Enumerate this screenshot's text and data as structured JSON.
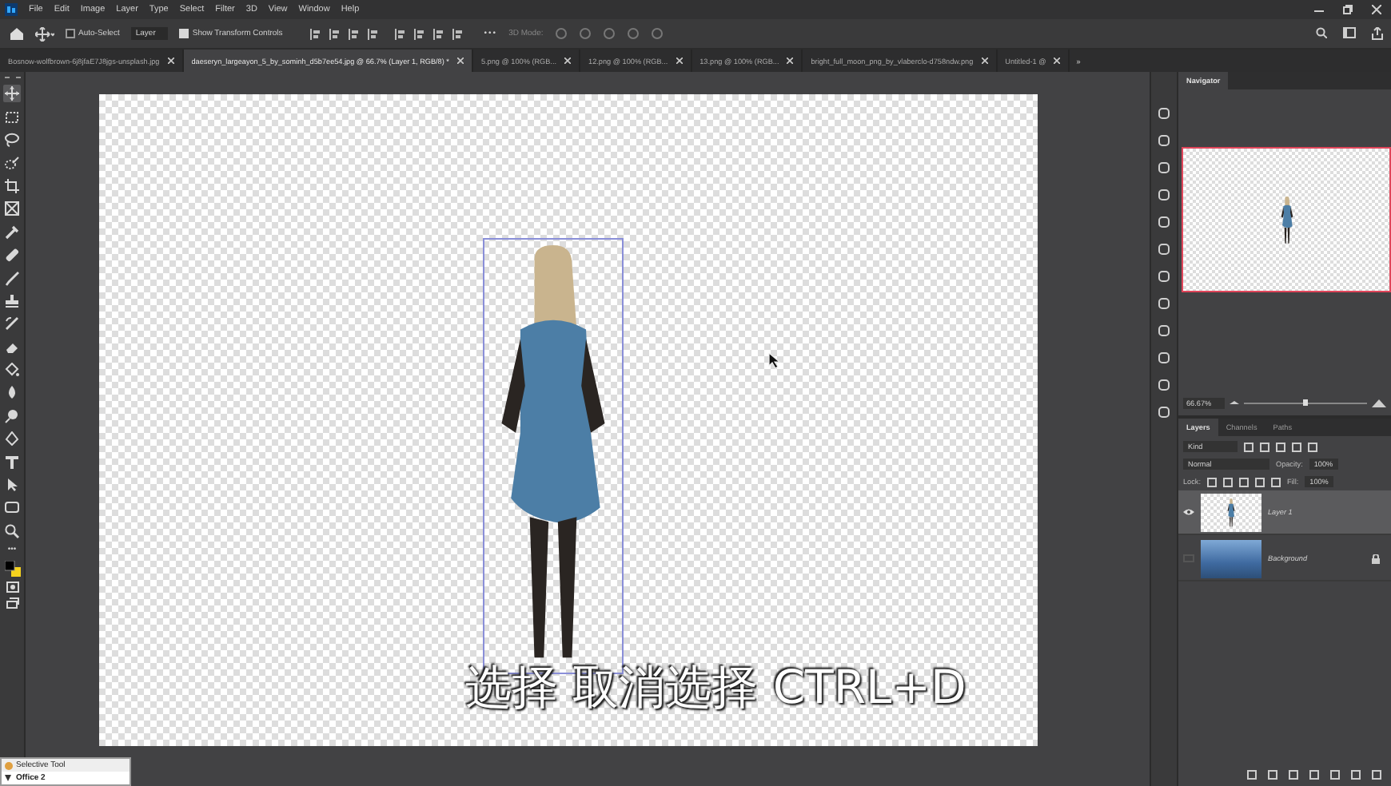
{
  "menu": [
    "File",
    "Edit",
    "Image",
    "Layer",
    "Type",
    "Select",
    "Filter",
    "3D",
    "View",
    "Window",
    "Help"
  ],
  "options": {
    "auto_select": {
      "label": "Auto-Select",
      "checked": false
    },
    "target": "Layer",
    "transform": {
      "label": "Show Transform Controls",
      "checked": true
    },
    "mode": "3D Mode:",
    "more": "•••"
  },
  "tools_more": "•••",
  "tabs": [
    {
      "label": "Bosnow-wolfbrown-6j8jfaE7J8jgs-unsplash.jpg",
      "selected": false
    },
    {
      "label": "daeseryn_largeayon_5_by_sominh_d5b7ee54.jpg @ 66.7% (Layer 1, RGB/8) *",
      "selected": true
    },
    {
      "label": "5.png @ 100% (RGB...",
      "selected": false
    },
    {
      "label": "12.png @ 100% (RGB...",
      "selected": false
    },
    {
      "label": "13.png @ 100% (RGB...",
      "selected": false
    },
    {
      "label": "bright_full_moon_png_by_vlaberclo-d758ndw.png",
      "selected": false
    },
    {
      "label": "Untitled-1 @",
      "selected": false
    }
  ],
  "tabs_overflow": "»",
  "tools": [
    {
      "selected": true
    },
    {
      "selected": false
    },
    {
      "selected": false
    },
    {
      "selected": false
    },
    {
      "selected": false
    },
    {
      "selected": false
    },
    {
      "selected": false
    },
    {
      "selected": false
    },
    {
      "selected": false
    },
    {
      "selected": false
    },
    {
      "selected": false
    },
    {
      "selected": false
    },
    {
      "selected": false
    },
    {
      "selected": false
    },
    {
      "selected": false
    },
    {
      "selected": false
    },
    {
      "selected": false
    },
    {
      "selected": false
    },
    {
      "selected": false
    },
    {
      "selected": false
    }
  ],
  "caption": "选择 取消选择 CTRL+D",
  "navigator": {
    "tab": "Navigator",
    "zoom": "66.67%",
    "level": 0.5
  },
  "layers_panel": {
    "tabs": [
      {
        "label": "Layers",
        "selected": true
      },
      {
        "label": "Channels",
        "selected": false
      },
      {
        "label": "Paths",
        "selected": false
      }
    ],
    "filter": "Kind",
    "blend": "Normal",
    "opacity_label": "Opacity:",
    "opacity": "100%",
    "lock_label": "Lock:",
    "fill_label": "Fill:",
    "fill": "100%",
    "layers": [
      {
        "name": "Layer 1",
        "visible": true,
        "selected": true,
        "locked": false,
        "kind": "transparent"
      },
      {
        "name": "Background",
        "visible": false,
        "selected": false,
        "locked": true,
        "kind": "photo"
      }
    ]
  },
  "floating_panel": {
    "title": "Selective Tool",
    "item": "Office 2"
  }
}
